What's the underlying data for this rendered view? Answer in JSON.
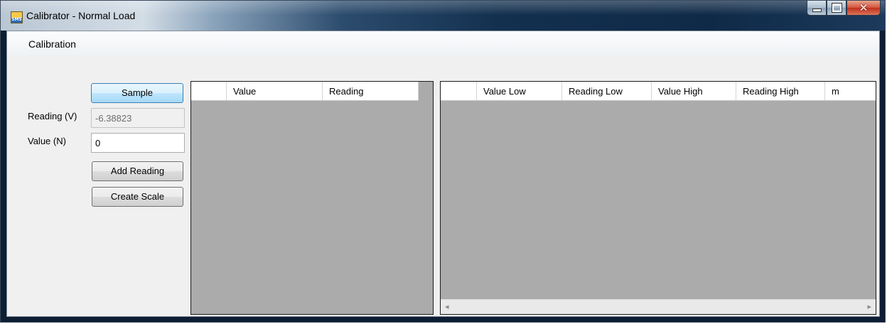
{
  "window": {
    "title": "Calibrator - Normal Load",
    "app_icon_text": "SMS",
    "min_glyph": "",
    "close_glyph": "✕"
  },
  "menu": {
    "items": [
      "Calibration"
    ]
  },
  "form": {
    "sample_label": "Sample",
    "reading_label": "Reading (V)",
    "reading_value": "-6.38823",
    "value_label": "Value (N)",
    "value_value": "0",
    "add_reading_label": "Add Reading",
    "create_scale_label": "Create Scale"
  },
  "readings_grid": {
    "columns": [
      "Value",
      "Reading"
    ],
    "rows": []
  },
  "scale_grid": {
    "columns": [
      "Value Low",
      "Reading Low",
      "Value High",
      "Reading High",
      "m"
    ],
    "rows": [],
    "scroll_left": "◂",
    "scroll_right": "▸"
  },
  "colors": {
    "grid_background": "#ababab",
    "client_background": "#f0f0f0"
  }
}
